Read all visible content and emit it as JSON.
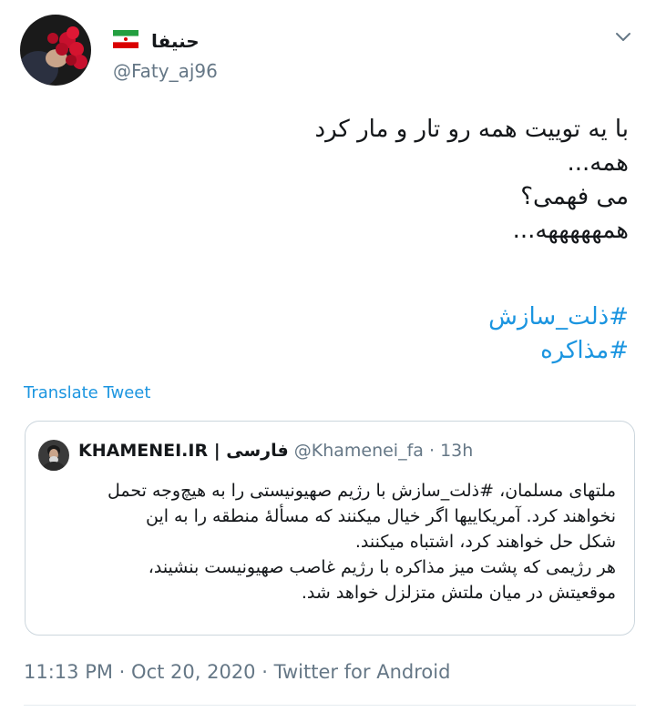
{
  "user": {
    "display_name": "حنیفا",
    "handle": "@Faty_aj96",
    "flag_icon": "iran-flag-icon"
  },
  "tweet": {
    "lines": [
      "با یه توییت همه رو تار و مار کرد",
      "همه...",
      "می فهمی؟",
      "همهههههه..."
    ],
    "hashtags": [
      "#ذلت_سازش",
      "#مذاکره"
    ],
    "translate_label": "Translate Tweet"
  },
  "quote": {
    "name": "KHAMENEI.IR | فارسی",
    "handle": "@Khamenei_fa",
    "separator": "·",
    "time": "13h",
    "lines": [
      "ملتهای مسلمان، #ذلت_سازش با رژیم صهیونیستی را به هیچ‌وجه تحمل",
      "نخواهند کرد. آمریکاییها اگر خیال میکنند که مسألهٔ منطقه را به این",
      "شکل حل خواهند کرد، اشتباه میکنند.",
      "هر رژیمی که پشت میز مذاکره با رژیم غاصب صهیونیست بنشیند،",
      "موقعیتش در میان ملتش متزلزل خواهد شد."
    ]
  },
  "footer": {
    "time": "11:13 PM",
    "sep1": "·",
    "date": "Oct 20, 2020",
    "sep2": "·",
    "source": "Twitter for Android"
  },
  "colors": {
    "link": "#1b95e0",
    "muted": "#657786",
    "border": "#ccd6dd"
  }
}
